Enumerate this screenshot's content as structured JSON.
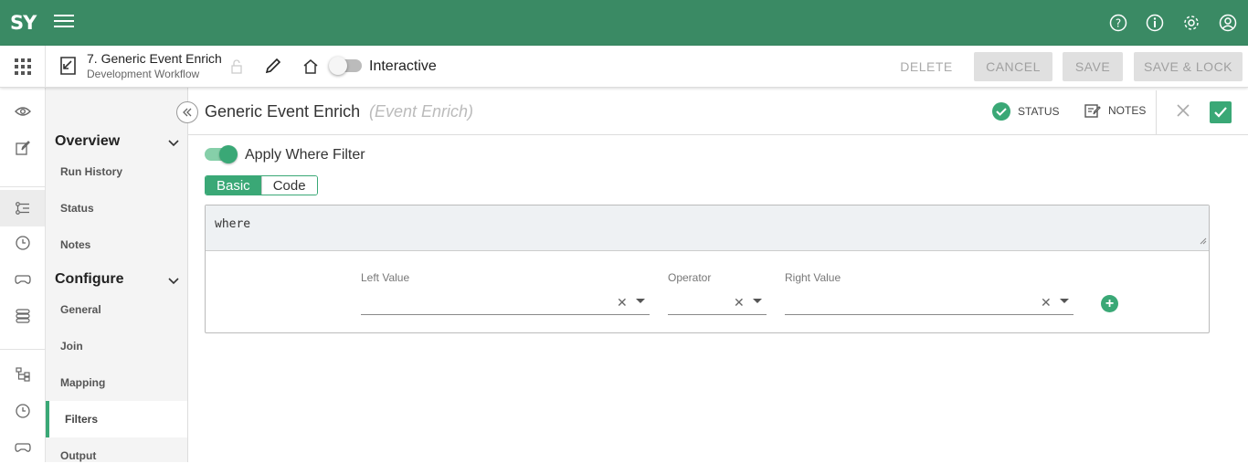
{
  "app": {
    "logo": "SY"
  },
  "toolbar": {
    "workflow_title": "7. Generic Event Enrich",
    "workflow_subtitle": "Development Workflow",
    "interactive_label": "Interactive",
    "delete_label": "DELETE",
    "cancel_label": "CANCEL",
    "save_label": "SAVE",
    "save_lock_label": "SAVE & LOCK"
  },
  "nav": {
    "overview": "Overview",
    "overview_items": [
      "Run History",
      "Status",
      "Notes"
    ],
    "configure": "Configure",
    "configure_items": [
      "General",
      "Join",
      "Mapping",
      "Filters",
      "Output"
    ],
    "active_item": "Filters"
  },
  "main": {
    "title": "Generic Event Enrich",
    "type": "(Event Enrich)",
    "status_label": "STATUS",
    "notes_label": "NOTES",
    "apply_where_label": "Apply Where Filter",
    "apply_where_enabled": true,
    "tabs": [
      "Basic",
      "Code"
    ],
    "active_tab": "Basic",
    "where_text": "where",
    "left_value_label": "Left Value",
    "operator_label": "Operator",
    "right_value_label": "Right Value"
  },
  "colors": {
    "brand": "#3a8a64",
    "accent": "#3aa876"
  }
}
